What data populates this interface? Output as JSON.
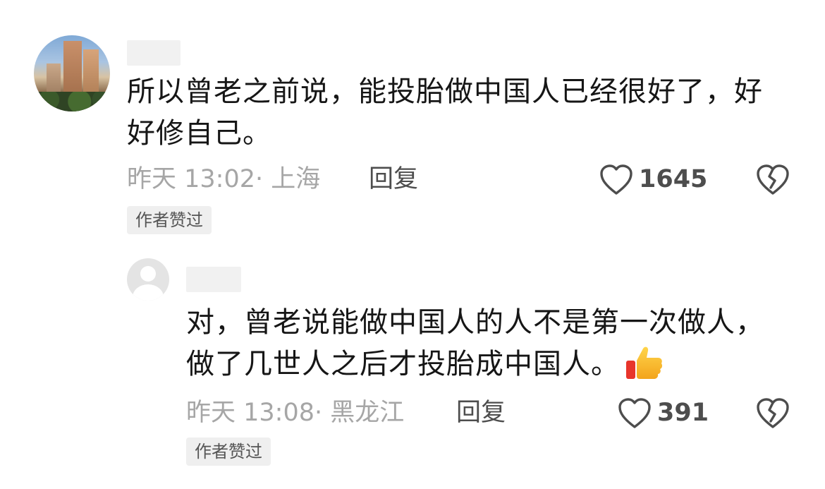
{
  "comments": [
    {
      "text": "所以曾老之前说，能投胎做中国人已经很好了，好好修自己。",
      "time": "昨天 13:02",
      "location": "· 上海",
      "reply_label": "回复",
      "likes": "1645",
      "badge": "作者赞过"
    },
    {
      "text": "对，曾老说能做中国人的人不是第一次做人，做了几世人之后才投胎成中国人。",
      "emoji": "thumbs-up",
      "time": "昨天 13:08",
      "location": "· 黑龙江",
      "reply_label": "回复",
      "likes": "391",
      "badge": "作者赞过"
    }
  ],
  "icons": {
    "like": "heart-outline-icon",
    "dislike": "broken-heart-icon",
    "thumb": "thumbs-up-icon"
  },
  "colors": {
    "text": "#161616",
    "meta": "#a6a6a6",
    "action": "#4d4d4d",
    "badge_bg": "#efefef"
  }
}
